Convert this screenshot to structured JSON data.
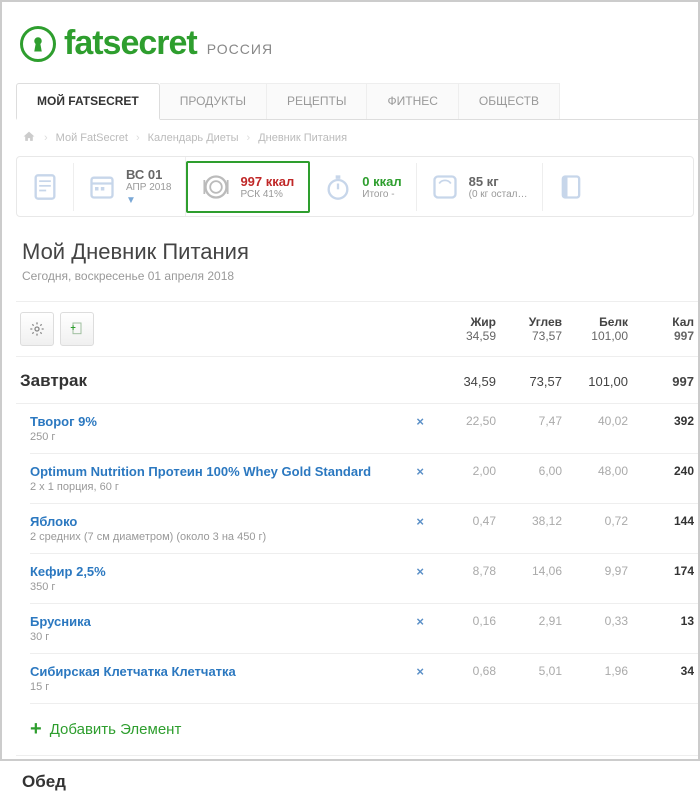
{
  "logo": {
    "text": "fatsecret",
    "region": "Россия"
  },
  "tabs": [
    "МОЙ FATSECRET",
    "ПРОДУКТЫ",
    "РЕЦЕПТЫ",
    "ФИТНЕС",
    "ОБЩЕСТВ"
  ],
  "breadcrumb": [
    "Мой FatSecret",
    "Календарь Диеты",
    "Дневник Питания"
  ],
  "summary": {
    "date": {
      "l1": "ВС 01",
      "l2": "АПР 2018"
    },
    "calories": {
      "l1": "997 ккал",
      "l2": "РСК 41%"
    },
    "fitness": {
      "l1": "0 ккал",
      "l2": "Итого -"
    },
    "weight": {
      "l1": "85 кг",
      "l2": "(0 кг остал…"
    }
  },
  "title": "Мой Дневник Питания",
  "subtitle": "Сегодня, воскресенье 01 апреля 2018",
  "totals": {
    "headers": {
      "fat": "Жир",
      "carb": "Углев",
      "prot": "Белк",
      "cal": "Кал"
    },
    "values": {
      "fat": "34,59",
      "carb": "73,57",
      "prot": "101,00",
      "cal": "997"
    }
  },
  "meal": {
    "name": "Завтрак",
    "totals": {
      "fat": "34,59",
      "carb": "73,57",
      "prot": "101,00",
      "cal": "997"
    },
    "items": [
      {
        "name": "Творог 9%",
        "qty": "250 г",
        "fat": "22,50",
        "carb": "7,47",
        "prot": "40,02",
        "cal": "392"
      },
      {
        "name": "Optimum Nutrition Протеин 100% Whey Gold Standard",
        "qty": "2 х 1 порция, 60 г",
        "fat": "2,00",
        "carb": "6,00",
        "prot": "48,00",
        "cal": "240"
      },
      {
        "name": "Яблоко",
        "qty": "2 средних (7 см диаметром) (около 3 на 450 г)",
        "fat": "0,47",
        "carb": "38,12",
        "prot": "0,72",
        "cal": "144"
      },
      {
        "name": "Кефир 2,5%",
        "qty": "350 г",
        "fat": "8,78",
        "carb": "14,06",
        "prot": "9,97",
        "cal": "174"
      },
      {
        "name": "Брусника",
        "qty": "30 г",
        "fat": "0,16",
        "carb": "2,91",
        "prot": "0,33",
        "cal": "13"
      },
      {
        "name": "Сибирская Клетчатка Клетчатка",
        "qty": "15 г",
        "fat": "0,68",
        "carb": "5,01",
        "prot": "1,96",
        "cal": "34"
      }
    ]
  },
  "addItem": "Добавить Элемент",
  "nextMeal": "Обед"
}
